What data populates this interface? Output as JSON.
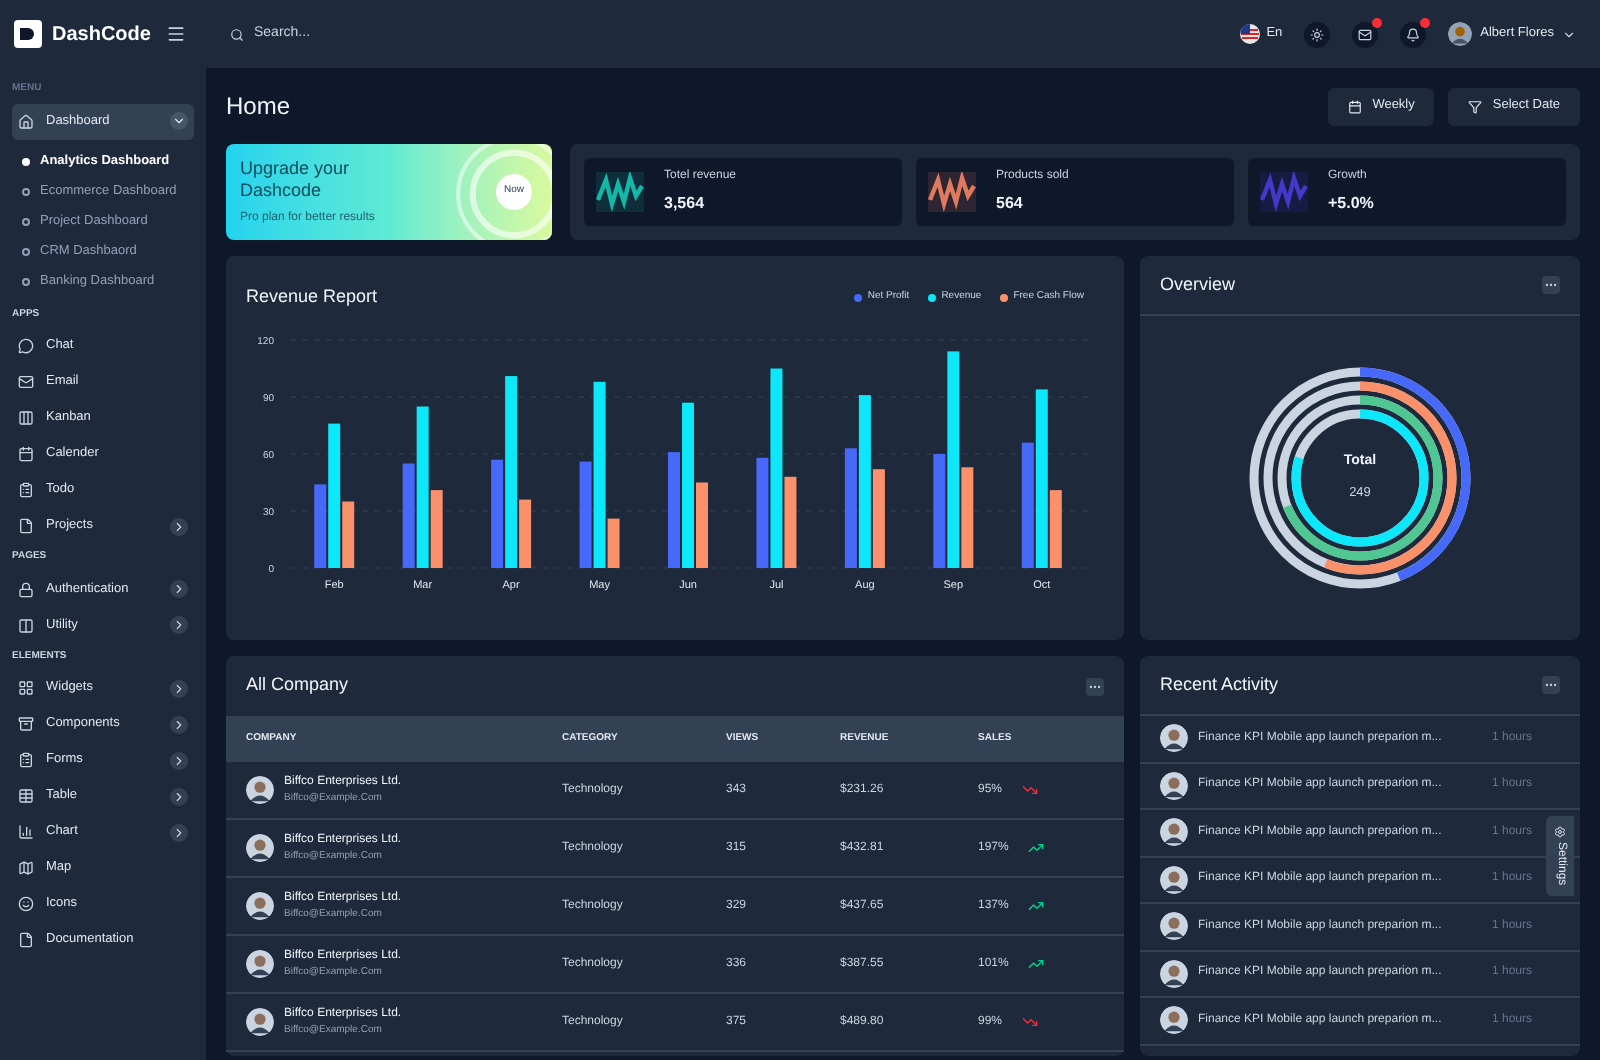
{
  "brand": "DashCode",
  "search": {
    "placeholder": "Search..."
  },
  "header": {
    "language": "En",
    "user": "Albert Flores"
  },
  "sidebar": {
    "sections": [
      {
        "title": "MENU",
        "items": [
          {
            "label": "Dashboard",
            "selected": true,
            "expanded": true,
            "children": [
              {
                "label": "Analytics Dashboard",
                "selected": true
              },
              {
                "label": "Ecommerce Dashboard",
                "selected": false
              },
              {
                "label": "Project Dashboard",
                "selected": false
              },
              {
                "label": "CRM Dashbaord",
                "selected": false
              },
              {
                "label": "Banking Dashboard",
                "selected": false
              }
            ]
          }
        ]
      },
      {
        "title": "APPS",
        "items": [
          {
            "label": "Chat",
            "selected": false
          },
          {
            "label": "Email",
            "selected": false
          },
          {
            "label": "Kanban",
            "selected": false
          },
          {
            "label": "Calender",
            "selected": false
          },
          {
            "label": "Todo",
            "selected": false
          },
          {
            "label": "Projects",
            "selected": false,
            "expanded": false
          }
        ]
      },
      {
        "title": "PAGES",
        "items": [
          {
            "label": "Authentication",
            "selected": false,
            "expanded": false
          },
          {
            "label": "Utility",
            "selected": false,
            "expanded": false
          }
        ]
      },
      {
        "title": "ELEMENTS",
        "items": [
          {
            "label": "Widgets",
            "selected": false,
            "expanded": false
          },
          {
            "label": "Components",
            "selected": false,
            "expanded": false
          },
          {
            "label": "Forms",
            "selected": false,
            "expanded": false
          },
          {
            "label": "Table",
            "selected": false,
            "expanded": false
          },
          {
            "label": "Chart",
            "selected": false,
            "expanded": false
          },
          {
            "label": "Map",
            "selected": false
          },
          {
            "label": "Icons",
            "selected": false
          },
          {
            "label": "Documentation",
            "selected": false
          }
        ]
      }
    ]
  },
  "page_title": "Home",
  "actions": [
    "Weekly",
    "Select Date"
  ],
  "upgrade": {
    "title": "Upgrade your Dashcode",
    "subtitle": "Pro plan for better results",
    "button": "Now"
  },
  "stats": [
    {
      "label": "Totel revenue",
      "value": "3,564",
      "color": "#14b8a6"
    },
    {
      "label": "Products sold",
      "value": "564",
      "color": "#e07a5f"
    },
    {
      "label": "Growth",
      "value": "+5.0%",
      "color": "#4338ca"
    }
  ],
  "revenue": {
    "title": "Revenue Report",
    "chart_data": {
      "type": "bar",
      "categories": [
        "Feb",
        "Mar",
        "Apr",
        "May",
        "Jun",
        "Jul",
        "Aug",
        "Sep",
        "Oct"
      ],
      "series": [
        {
          "name": "Net Profit",
          "color": "#4669fa",
          "values": [
            44,
            55,
            57,
            56,
            61,
            58,
            63,
            60,
            66
          ]
        },
        {
          "name": "Revenue",
          "color": "#0ce7fa",
          "values": [
            76,
            85,
            101,
            98,
            87,
            105,
            91,
            114,
            94
          ]
        },
        {
          "name": "Free Cash Flow",
          "color": "#fa916b",
          "values": [
            35,
            41,
            36,
            26,
            45,
            48,
            52,
            53,
            41
          ]
        }
      ],
      "ylim": [
        0,
        120
      ],
      "yticks": [
        0,
        30,
        60,
        90,
        120
      ],
      "grid": true
    }
  },
  "overview": {
    "title": "Overview",
    "center_label": "Total",
    "center_value": "249"
  },
  "company": {
    "title": "All Company",
    "columns": [
      "COMPANY",
      "CATEGORY",
      "VIEWS",
      "REVENUE",
      "SALES"
    ],
    "rows": [
      {
        "name": "Biffco Enterprises Ltd.",
        "email": "Biffco@Example.Com",
        "category": "Technology",
        "views": "343",
        "revenue": "$231.26",
        "sales": "95%",
        "kind": "down"
      },
      {
        "name": "Biffco Enterprises Ltd.",
        "email": "Biffco@Example.Com",
        "category": "Technology",
        "views": "315",
        "revenue": "$432.81",
        "sales": "197%",
        "kind": "up"
      },
      {
        "name": "Biffco Enterprises Ltd.",
        "email": "Biffco@Example.Com",
        "category": "Technology",
        "views": "329",
        "revenue": "$437.65",
        "sales": "137%",
        "kind": "up"
      },
      {
        "name": "Biffco Enterprises Ltd.",
        "email": "Biffco@Example.Com",
        "category": "Technology",
        "views": "336",
        "revenue": "$387.55",
        "sales": "101%",
        "kind": "up"
      },
      {
        "name": "Biffco Enterprises Ltd.",
        "email": "Biffco@Example.Com",
        "category": "Technology",
        "views": "375",
        "revenue": "$489.80",
        "sales": "99%",
        "kind": "down"
      }
    ]
  },
  "activity": {
    "title": "Recent Activity",
    "items": [
      {
        "text": "Finance KPI Mobile app launch preparion m...",
        "time": "1 hours"
      },
      {
        "text": "Finance KPI Mobile app launch preparion m...",
        "time": "1 hours"
      },
      {
        "text": "Finance KPI Mobile app launch preparion m...",
        "time": "1 hours"
      },
      {
        "text": "Finance KPI Mobile app launch preparion m...",
        "time": "1 hours"
      },
      {
        "text": "Finance KPI Mobile app launch preparion m...",
        "time": "1 hours"
      },
      {
        "text": "Finance KPI Mobile app launch preparion m...",
        "time": "1 hours"
      },
      {
        "text": "Finance KPI Mobile app launch preparion m...",
        "time": "1 hours"
      }
    ]
  },
  "settings_tab": "Settings"
}
